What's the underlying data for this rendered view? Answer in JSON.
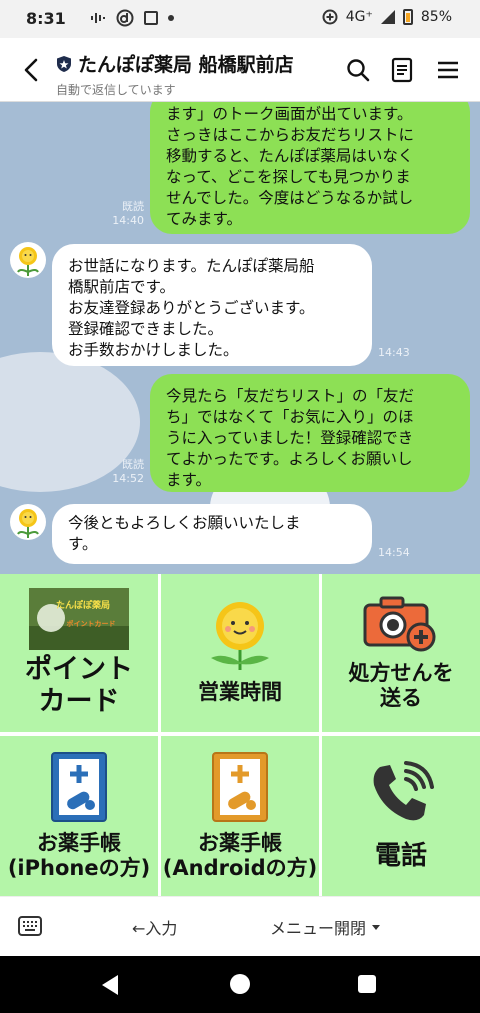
{
  "status": {
    "time": "8:31",
    "network": "4G⁺",
    "battery": "85%"
  },
  "header": {
    "title": "たんぽぽ薬局 船橋駅前店",
    "subtitle": "自動で返信しています"
  },
  "messages": [
    {
      "side": "me",
      "lines": [
        "ます」のトーク画面が出ています。",
        "さっきはここからお友だちリストに",
        "移動すると、たんぽぽ薬局はいなく",
        "なって、どこを探しても見つかりま",
        "せんでした。今度はどうなるか試し",
        "てみます。"
      ],
      "read": "既読",
      "time": "14:40"
    },
    {
      "side": "them",
      "lines": [
        "お世話になります。たんぽぽ薬局船",
        "橋駅前店です。",
        "お友達登録ありがとうございます。",
        "登録確認できました。",
        "お手数おかけしました。"
      ],
      "time": "14:43"
    },
    {
      "side": "me",
      "lines": [
        "今見たら「友だちリスト」の「友だ",
        "ち」ではなくて「お気に入り」のほ",
        "うに入っていました！登録確認でき",
        "てよかったです。よろしくお願いし",
        "ます。"
      ],
      "read": "既読",
      "time": "14:52"
    },
    {
      "side": "them",
      "lines": [
        "今後ともよろしくお願いいたしま",
        "す。"
      ],
      "time": "14:54"
    }
  ],
  "menu": {
    "point_card": {
      "lines": [
        "ポイント",
        "カード"
      ],
      "image_lines": [
        "たんぽぽ薬局",
        "ポイントカード"
      ]
    },
    "hours": {
      "lines": [
        "営業時間"
      ]
    },
    "prescription": {
      "lines": [
        "処方せんを",
        "送る"
      ]
    },
    "notebook_ios": {
      "lines": [
        "お薬手帳",
        "(iPhoneの方)"
      ]
    },
    "notebook_android": {
      "lines": [
        "お薬手帳",
        "(Androidの方)"
      ]
    },
    "phone": {
      "lines": [
        "電話"
      ]
    }
  },
  "inputbar": {
    "input_hint": "←入力",
    "menu_open": "メニュー開閉"
  },
  "icons": {
    "back": "chevron-left-icon",
    "search": "search-icon",
    "notes": "notes-icon",
    "menu": "hamburger-icon",
    "keyboard": "keyboard-icon"
  },
  "colors": {
    "chat_bg": "#a5bcd4",
    "my_bubble": "#8de055",
    "menu_tile": "#b4f5a8"
  }
}
